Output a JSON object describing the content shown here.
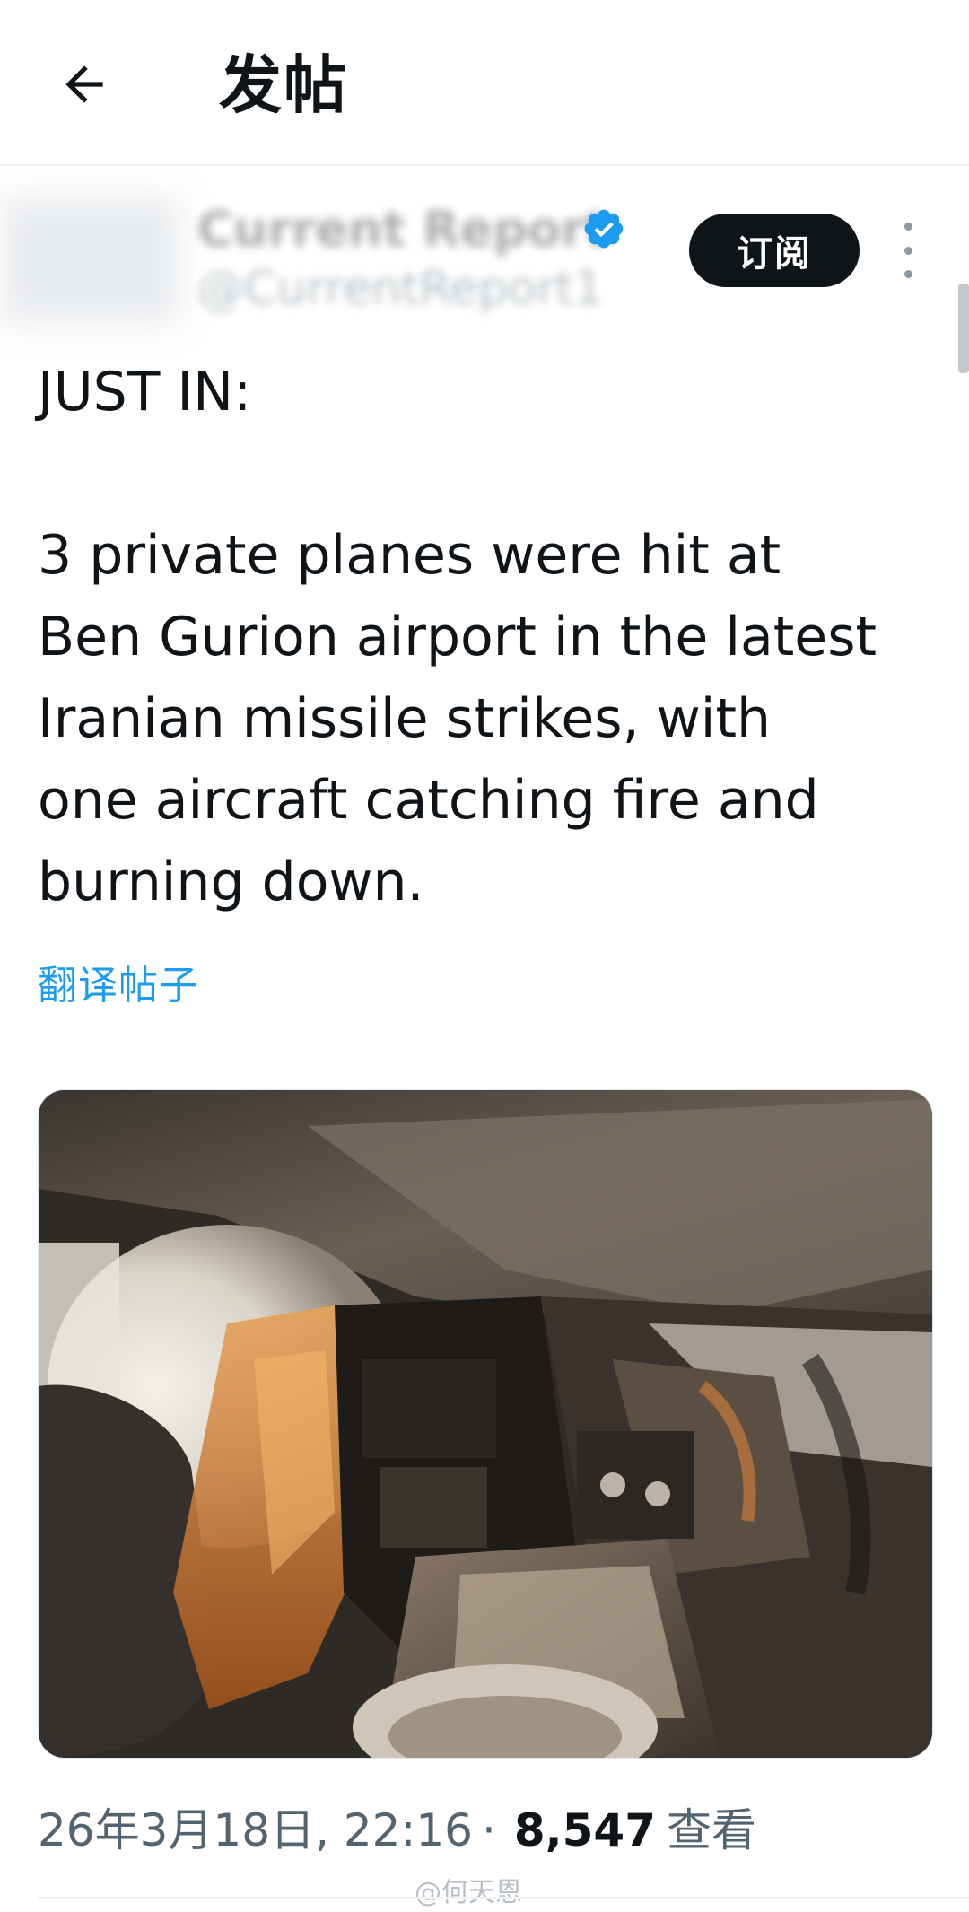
{
  "header": {
    "title": "发帖",
    "back_icon": "arrow-left-icon"
  },
  "author": {
    "name": "Current Report",
    "handle": "@CurrentReport1",
    "verified_icon": "verified-badge-icon",
    "subscribe_label": "订阅",
    "more_icon": "more-vertical-icon"
  },
  "post": {
    "lead": "JUST IN:",
    "body_lines": [
      "3 private planes were hit at",
      "Ben Gurion airport in the latest",
      "Iranian missile strikes, with",
      "one aircraft catching fire and",
      "burning down."
    ],
    "translate_label": "翻译帖子"
  },
  "media": {
    "description_icon": "burned-cockpit-photo"
  },
  "footer": {
    "timestamp": "26年3月18日, 22:16",
    "separator": "·",
    "views_count": "8,547",
    "views_label": "查看"
  },
  "watermark": "@何天恩",
  "colors": {
    "accent": "#1d9bf0",
    "text": "#0f1419",
    "secondary": "#536471",
    "button_bg": "#0f1419"
  }
}
